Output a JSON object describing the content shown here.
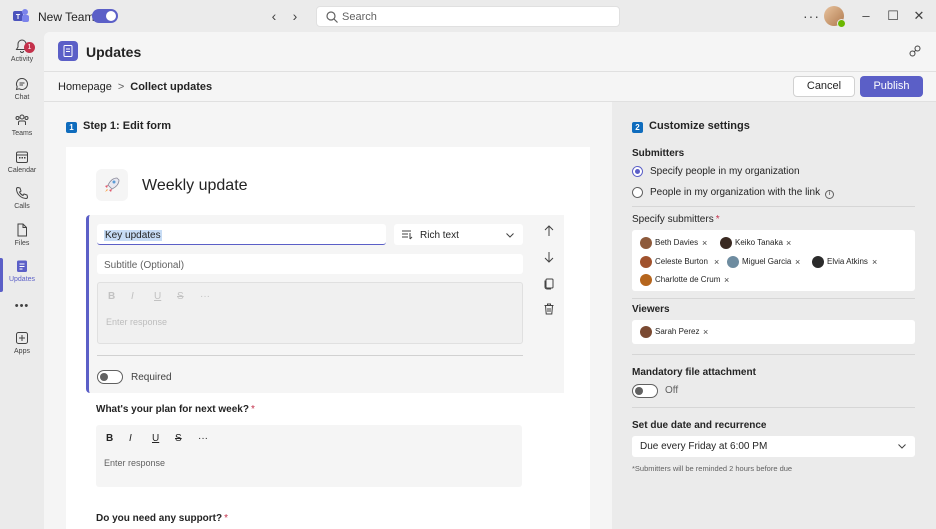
{
  "titlebar": {
    "app_label": "New Teams",
    "search_placeholder": "Search",
    "more": "···"
  },
  "rail": {
    "activity_badge": "1",
    "items": [
      {
        "label": "Activity"
      },
      {
        "label": "Chat"
      },
      {
        "label": "Teams"
      },
      {
        "label": "Calendar"
      },
      {
        "label": "Calls"
      },
      {
        "label": "Files"
      },
      {
        "label": "Updates"
      },
      {
        "label": "Apps"
      }
    ],
    "more": "•••"
  },
  "header": {
    "title": "Updates"
  },
  "breadcrumb": {
    "home": "Homepage",
    "separator": ">",
    "current": "Collect updates"
  },
  "actions": {
    "cancel": "Cancel",
    "publish": "Publish"
  },
  "step1": {
    "number": "1",
    "title": "Step 1: Edit form",
    "form_title": "Weekly update",
    "question1": {
      "title_value": "Key updates",
      "type": "Rich text",
      "subtitle_placeholder": "Subtitle (Optional)",
      "format": [
        "B",
        "I",
        "U",
        "S",
        "···"
      ],
      "response_placeholder": "Enter response",
      "required_label": "Required"
    },
    "question2": {
      "label": "What's your plan for next week?",
      "required_mark": "*",
      "format": [
        "B",
        "I",
        "U",
        "S",
        "···"
      ],
      "response_placeholder": "Enter response"
    },
    "question3": {
      "label": "Do you need any support?",
      "required_mark": "*"
    }
  },
  "step2": {
    "number": "2",
    "title": "Customize settings",
    "submitters_label": "Submitters",
    "option_org": "Specify people in my organization",
    "option_link": "People in my organization with the link",
    "info": "i",
    "specify_label": "Specify submitters",
    "required_mark": "*",
    "submitters": [
      {
        "name": "Beth Davies"
      },
      {
        "name": "Keiko Tanaka"
      },
      {
        "name": "Celeste Burton"
      },
      {
        "name": "Miguel Garcia"
      },
      {
        "name": "Elvia Atkins"
      },
      {
        "name": "Charlotte de Crum"
      }
    ],
    "remove": "×",
    "viewers_label": "Viewers",
    "viewers": [
      {
        "name": "Sarah Perez"
      }
    ],
    "attachment_label": "Mandatory file attachment",
    "attachment_state": "Off",
    "due_label": "Set due date and recurrence",
    "due_value": "Due every Friday at 6:00 PM",
    "reminder_note": "*Submitters will be reminded 2 hours before due"
  },
  "colors": {
    "brand": "#5b5fc7",
    "required": "#c4314b",
    "step_badge": "#0f6cbd"
  }
}
